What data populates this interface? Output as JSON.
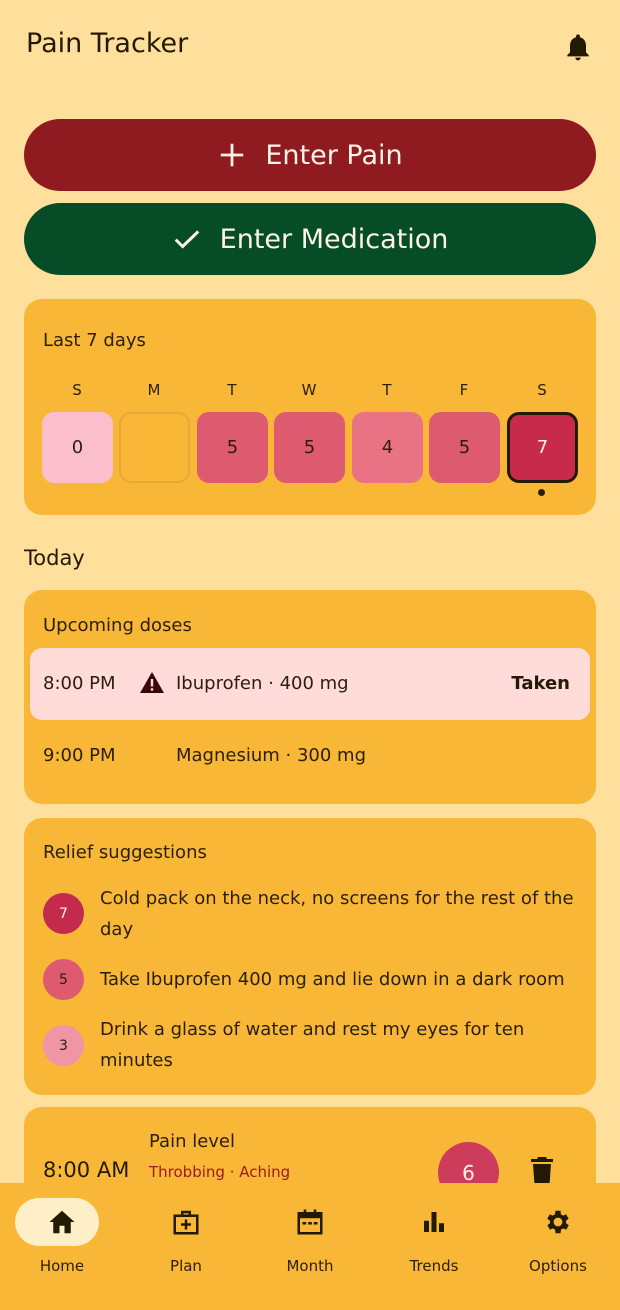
{
  "app": {
    "title": "Pain Tracker"
  },
  "actions": {
    "enter_pain": "Enter Pain",
    "enter_medication": "Enter Medication"
  },
  "week": {
    "title": "Last 7 days",
    "days": [
      {
        "letter": "S",
        "value": "0",
        "color": "#FBBFCB",
        "today": false
      },
      {
        "letter": "M",
        "value": "",
        "color": "#F9B737",
        "today": false
      },
      {
        "letter": "T",
        "value": "5",
        "color": "#DE5A70",
        "today": false
      },
      {
        "letter": "W",
        "value": "5",
        "color": "#DE5A70",
        "today": false
      },
      {
        "letter": "T",
        "value": "4",
        "color": "#EA7285",
        "today": false
      },
      {
        "letter": "F",
        "value": "5",
        "color": "#DE5A70",
        "today": false
      },
      {
        "letter": "S",
        "value": "7",
        "color": "#C82A4C",
        "today": true
      }
    ]
  },
  "today": {
    "heading": "Today",
    "doses": {
      "title": "Upcoming doses",
      "items": [
        {
          "time": "8:00 PM",
          "name": "Ibuprofen · 400 mg",
          "status": "Taken",
          "warning": true
        },
        {
          "time": "9:00 PM",
          "name": "Magnesium · 300 mg",
          "status": "",
          "warning": false
        }
      ]
    },
    "relief": {
      "title": "Relief suggestions",
      "items": [
        {
          "level": "7",
          "color": "#C32A4B",
          "text": "Cold pack on the neck, no screens for the rest of the day"
        },
        {
          "level": "5",
          "color": "#DE5A70",
          "text": "Take Ibuprofen 400 mg and lie down in a dark room"
        },
        {
          "level": "3",
          "color": "#F095A5",
          "text": "Drink a glass of water and rest my eyes for ten minutes"
        }
      ]
    },
    "entry": {
      "time": "8:00 AM",
      "label": "Pain level",
      "tags": "Throbbing · Aching",
      "level": "6"
    }
  },
  "nav": {
    "items": [
      {
        "label": "Home",
        "icon": "home-icon",
        "active": true
      },
      {
        "label": "Plan",
        "icon": "medical-kit-icon",
        "active": false
      },
      {
        "label": "Month",
        "icon": "calendar-icon",
        "active": false
      },
      {
        "label": "Trends",
        "icon": "bar-chart-icon",
        "active": false
      },
      {
        "label": "Options",
        "icon": "settings-gear-icon",
        "active": false
      }
    ]
  }
}
